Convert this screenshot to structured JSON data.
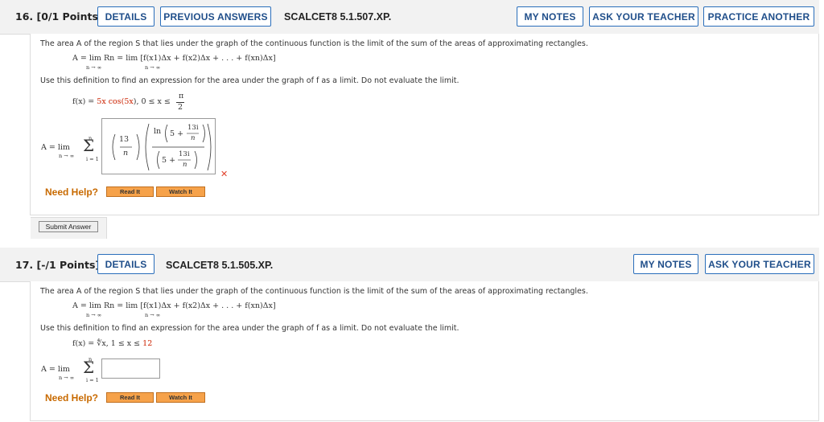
{
  "q16": {
    "number": "16.",
    "points": "[0/1 Points]",
    "details": "DETAILS",
    "previous_answers": "PREVIOUS ANSWERS",
    "code": "SCALCET8 5.1.507.XP.",
    "my_notes": "MY NOTES",
    "ask_teacher": "ASK YOUR TEACHER",
    "practice_another": "PRACTICE ANOTHER",
    "intro": "The area A of the region S that lies under the graph of the continuous function is the limit of the sum of the areas of approximating rectangles.",
    "formula": "A =  lim  Rn =  lim  [f(x1)Δx + f(x2)Δx + . . . + f(xn)Δx]",
    "instruction": "Use this definition to find an expression for the area under the graph of f as a limit. Do not evaluate the limit.",
    "function_lhs": "f(x) = ",
    "function_coef": "5x cos(",
    "function_arg": "5x",
    "function_close": "),  0 ≤ x ≤",
    "interval_num": "π",
    "interval_den": "2",
    "answer_prefix": "A =  lim",
    "limit_sub": "n → ∞",
    "sum_upper": "n",
    "sum_lower": "i = 1",
    "answer_frac_num": "13",
    "answer_frac_den": "n",
    "answer_ln": "ln",
    "answer_five1": "5 +",
    "answer_inner_num1": "13i",
    "answer_inner_den1": "n",
    "answer_five2": "5 +",
    "answer_inner_num2": "13i",
    "answer_inner_den2": "n",
    "wrong_mark": "✕",
    "need_help": "Need Help?",
    "read_it": "Read It",
    "watch_it": "Watch It",
    "submit": "Submit Answer"
  },
  "q17": {
    "number": "17.",
    "points": "[-/1 Points]",
    "details": "DETAILS",
    "code": "SCALCET8 5.1.505.XP.",
    "my_notes": "MY NOTES",
    "ask_teacher": "ASK YOUR TEACHER",
    "intro": "The area A of the region S that lies under the graph of the continuous function is the limit of the sum of the areas of approximating rectangles.",
    "formula": "A =  lim  Rn =  lim  [f(x1)Δx + f(x2)Δx + . . . + f(xn)Δx]",
    "instruction": "Use this definition to find an expression for the area under the graph of f as a limit. Do not evaluate the limit.",
    "function_lhs": "f(x) = ",
    "function_root": "∜x",
    "function_range": ",  1 ≤ x ≤ ",
    "function_upper": "12",
    "answer_prefix": "A =  lim",
    "limit_sub": "n → ∞",
    "sum_upper": "n",
    "sum_lower": "i = 1",
    "need_help": "Need Help?",
    "read_it": "Read It",
    "watch_it": "Watch It"
  },
  "colors": {
    "accent": "#2a6ebb",
    "help": "#c86a00",
    "help_button": "#f6a24a",
    "error": "#cc2200"
  }
}
